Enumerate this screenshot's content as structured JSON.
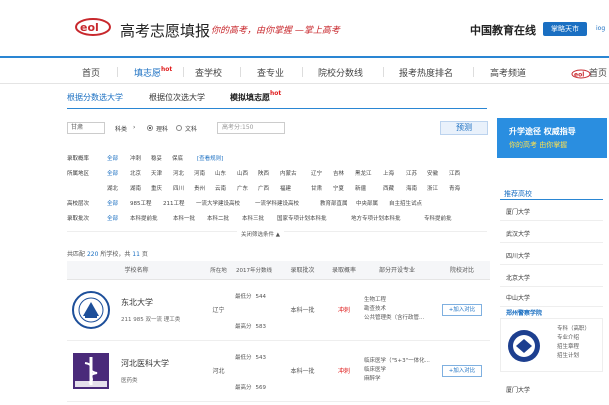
{
  "header": {
    "site_title": "高考志愿填报",
    "slogan": "你的高考，由你掌握 —掌上高考",
    "brand": "中国教育在线",
    "top_button": "掌略天市",
    "top_more": "iog"
  },
  "nav": {
    "items": [
      "首页",
      "填志愿",
      "查学校",
      "查专业",
      "院校分数线",
      "报考热度排名",
      "高考频道",
      "首页"
    ],
    "hot": "hot"
  },
  "subtabs": {
    "items": [
      "根据分数选大学",
      "根据位次选大学",
      "模拟填志愿"
    ],
    "hot": "hot"
  },
  "filters": {
    "province": "甘肃",
    "subject": "科类",
    "score_label": "高考分",
    "radio_science": "理科",
    "radio_arts": "文科",
    "score_placeholder": "高考分:150",
    "predict_button": "预测",
    "rows": [
      {
        "key": "录取概率",
        "opts": [
          "全部",
          "冲刺",
          "稳妥",
          "保底",
          "[查看规则]"
        ]
      },
      {
        "key": "所属地区",
        "opts": [
          "全部",
          "北京",
          "天津",
          "河北",
          "河南",
          "山东",
          "山西",
          "陕西",
          "内蒙古",
          "辽宁",
          "吉林",
          "黑龙江",
          "上海",
          "江苏",
          "安徽",
          "江西"
        ]
      },
      {
        "key": "",
        "opts": [
          "湖北",
          "湖南",
          "重庆",
          "四川",
          "贵州",
          "云南",
          "广东",
          "广西",
          "福建",
          "甘肃",
          "宁夏",
          "新疆",
          "西藏",
          "海南",
          "浙江",
          "青海"
        ]
      },
      {
        "key": "高校层次",
        "opts": [
          "全部",
          "985工程",
          "211工程",
          "一流大学建设高校",
          "一流学科建设高校",
          "教育部直属",
          "中央部属",
          "自主招生试点"
        ]
      },
      {
        "key": "录取批次",
        "opts": [
          "全部",
          "本科提前批",
          "本科一批",
          "本科二批",
          "本科三批",
          "国家专项计划本科批",
          "地方专项计划本科批",
          "专科提前批"
        ]
      }
    ],
    "toggle_advanced": "关闭筛选条件 ▲"
  },
  "results": {
    "count_prefix": "共匹配",
    "count": "220",
    "count_mid": "所学校，共",
    "pages": "11",
    "count_suffix": "页",
    "headers": [
      "学校名称",
      "所在地",
      "2017年分数线",
      "录取批次",
      "录取概率",
      "部分开设专业",
      "院校对比"
    ],
    "rows": [
      {
        "name": "东北大学",
        "tags": "211  985  双一流  理工类",
        "location": "辽宁",
        "min_label": "最低分",
        "min": "544",
        "avg_label": "最高分",
        "avg": "583",
        "batch": "本科一批",
        "risk": "冲刺",
        "majors": [
          "生物工程",
          "勘查技术",
          "公共管理类（含行政管..."
        ],
        "compare": "+加入对比"
      },
      {
        "name": "河北医科大学",
        "tags": "医药类",
        "location": "河北",
        "min_label": "最低分",
        "min": "543",
        "avg_label": "最高分",
        "avg": "569",
        "batch": "本科一批",
        "risk": "冲刺",
        "majors": [
          "临床医学（\"5+3\"一体化...",
          "临床医学",
          "麻醉学"
        ],
        "compare": "+加入对比"
      }
    ]
  },
  "sidebar": {
    "banner_line1": "升学途径 权威指导",
    "banner_line2": "你的高考 由你掌握",
    "rec_title": "推荐高校",
    "rec_items": [
      "厦门大学",
      "武汉大学",
      "四川大学",
      "北京大学",
      "中山大学",
      "郑州警察学院"
    ],
    "card_links": [
      "专科（高职）",
      "专业介绍",
      "招生章程",
      "招生计划"
    ],
    "rec_last": "厦门大学"
  },
  "colors": {
    "accent": "#1a6fc2",
    "hot": "#e02020",
    "brand_red": "#c8282d"
  }
}
